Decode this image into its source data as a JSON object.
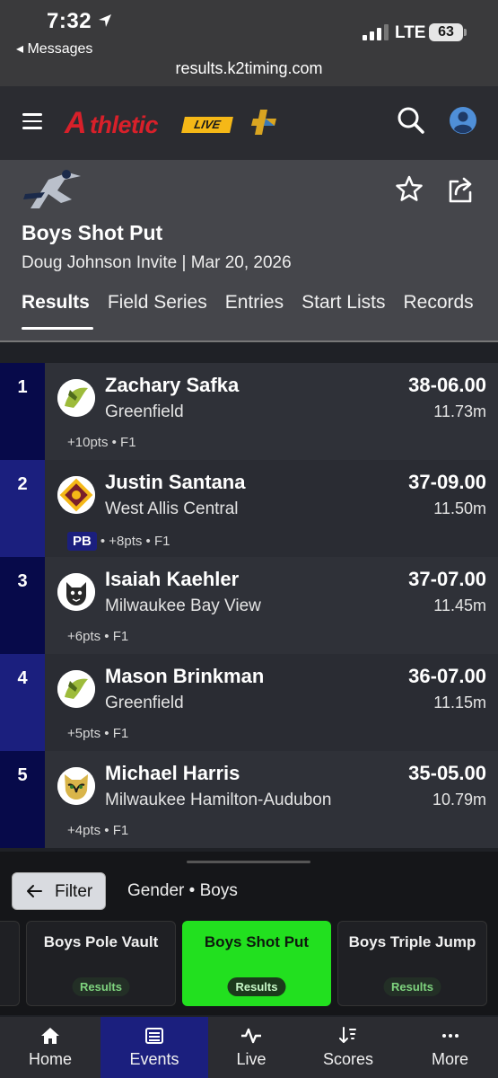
{
  "status": {
    "time": "7:32",
    "back": "◂ Messages",
    "network": "LTE",
    "battery": "63",
    "url": "results.k2timing.com"
  },
  "app": {
    "logo_a": "A",
    "logo_thletic": "thletic",
    "logo_live": "LIVE"
  },
  "event": {
    "title": "Boys Shot Put",
    "subtitle": "Doug Johnson Invite | Mar 20, 2026",
    "tabs": [
      "Results",
      "Field Series",
      "Entries",
      "Start Lists",
      "Records"
    ]
  },
  "results": [
    {
      "place": "1",
      "name": "Zachary Safka",
      "school": "Greenfield",
      "mark": "38-06.00",
      "metric": "11.73m",
      "meta": "+10pts • F1",
      "pb": ""
    },
    {
      "place": "2",
      "name": "Justin Santana",
      "school": "West Allis Central",
      "mark": "37-09.00",
      "metric": "11.50m",
      "meta": "• +8pts • F1",
      "pb": "PB"
    },
    {
      "place": "3",
      "name": "Isaiah Kaehler",
      "school": "Milwaukee Bay View",
      "mark": "37-07.00",
      "metric": "11.45m",
      "meta": "+6pts • F1",
      "pb": ""
    },
    {
      "place": "4",
      "name": "Mason Brinkman",
      "school": "Greenfield",
      "mark": "36-07.00",
      "metric": "11.15m",
      "meta": "+5pts • F1",
      "pb": ""
    },
    {
      "place": "5",
      "name": "Michael Harris",
      "school": "Milwaukee Hamilton-Audubon",
      "mark": "35-05.00",
      "metric": "10.79m",
      "meta": "+4pts • F1",
      "pb": ""
    }
  ],
  "sheet": {
    "filter_label": "Filter",
    "gender": "Gender • Boys",
    "events": [
      {
        "name": "Boys Pole Vault",
        "badge": "Results"
      },
      {
        "name": "Boys Shot Put",
        "badge": "Results"
      },
      {
        "name": "Boys Triple Jump",
        "badge": "Results"
      }
    ]
  },
  "nav": [
    "Home",
    "Events",
    "Live",
    "Scores",
    "More"
  ],
  "colors": {
    "accent": "#1b1f7e",
    "active_event": "#22e01f",
    "brand_red": "#d8202a",
    "brand_gold": "#f5b817"
  }
}
